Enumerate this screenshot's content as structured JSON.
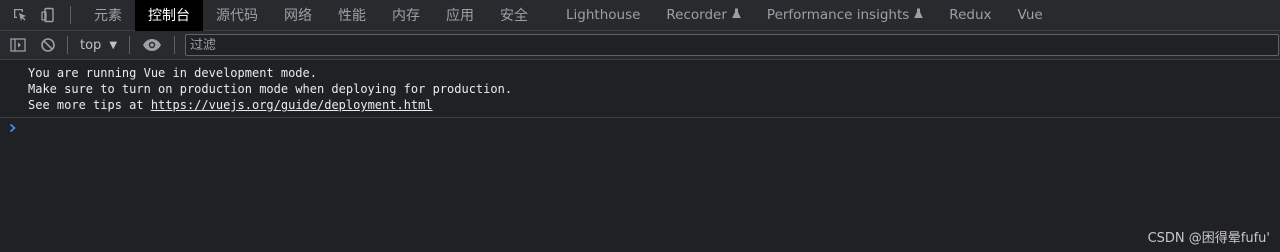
{
  "tabs": [
    {
      "label": "元素",
      "active": false,
      "flask": false,
      "cjk": true
    },
    {
      "label": "控制台",
      "active": true,
      "flask": false,
      "cjk": true
    },
    {
      "label": "源代码",
      "active": false,
      "flask": false,
      "cjk": true
    },
    {
      "label": "网络",
      "active": false,
      "flask": false,
      "cjk": true
    },
    {
      "label": "性能",
      "active": false,
      "flask": false,
      "cjk": true
    },
    {
      "label": "内存",
      "active": false,
      "flask": false,
      "cjk": true
    },
    {
      "label": "应用",
      "active": false,
      "flask": false,
      "cjk": true
    },
    {
      "label": "安全",
      "active": false,
      "flask": false,
      "cjk": true
    },
    {
      "label": "Lighthouse",
      "active": false,
      "flask": false,
      "cjk": false
    },
    {
      "label": "Recorder",
      "active": false,
      "flask": true,
      "cjk": false
    },
    {
      "label": "Performance insights",
      "active": false,
      "flask": true,
      "cjk": false
    },
    {
      "label": "Redux",
      "active": false,
      "flask": false,
      "cjk": false
    },
    {
      "label": "Vue",
      "active": false,
      "flask": false,
      "cjk": false
    }
  ],
  "toolbar": {
    "context": "top",
    "filter_placeholder": "过滤"
  },
  "console": {
    "line1": "You are running Vue in development mode.",
    "line2": "Make sure to turn on production mode when deploying for production.",
    "line3_prefix": "See more tips at ",
    "line3_link": "https://vuejs.org/guide/deployment.html"
  },
  "watermark": "CSDN @困得晕fufu'",
  "colors": {
    "background": "#202124",
    "toolbar": "#292a2d",
    "active_tab": "#000000",
    "prompt": "#4d90fe"
  }
}
